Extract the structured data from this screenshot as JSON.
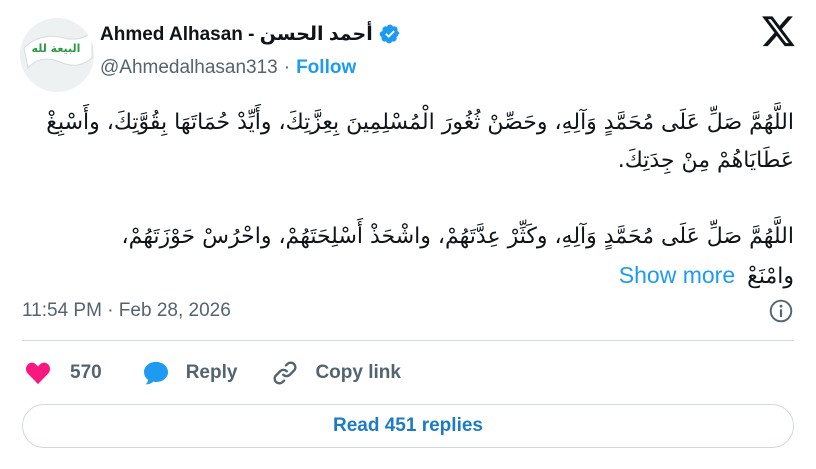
{
  "author": {
    "name": "Ahmed Alhasan - أحمد الحسن",
    "handle": "@Ahmedalhasan313",
    "separator": "·",
    "follow_label": "Follow",
    "avatar_text": "البيعة لله"
  },
  "tweet": {
    "paragraphs": [
      "اللَّهُمَّ صَلِّ عَلَى مُحَمَّدٍ وَآلِهِ، وحَصِّنْ ثُغُورَ الْمُسْلِمِينَ بِعِزَّتِكَ، وأَيِّدْ حُمَاتَهَا بِقُوَّتِكَ، وأَسْبِغْ عَطَايَاهُمْ مِنْ جِدَتِكَ.",
      "اللَّهُمَّ صَلِّ عَلَى مُحَمَّدٍ وَآلِهِ، وكَثِّرْ عِدَّتَهُمْ، واشْحَذْ أَسْلِحَتَهُمْ، واحْرُسْ حَوْزَتَهُمْ، وامْنَعْ"
    ],
    "show_more_label": "Show more",
    "timestamp": "11:54 PM · Feb 28, 2026"
  },
  "actions": {
    "like_count": "570",
    "reply_label": "Reply",
    "copy_label": "Copy link"
  },
  "read_replies_label": "Read 451 replies",
  "colors": {
    "accent": "#1d9bf0",
    "like": "#f91880",
    "text": "#0f1419",
    "muted": "#536471"
  }
}
